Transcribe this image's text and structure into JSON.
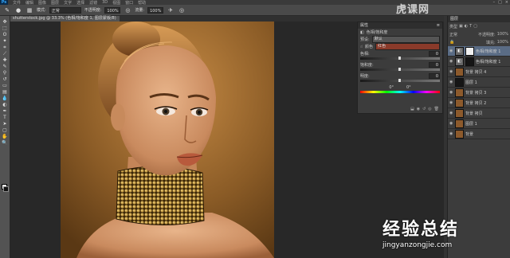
{
  "app": {
    "logo": "Ps"
  },
  "menubar": {
    "items": [
      "文件",
      "编辑",
      "图像",
      "图层",
      "文字",
      "选择",
      "滤镜",
      "3D",
      "视图",
      "窗口",
      "帮助"
    ]
  },
  "window_controls": [
    "–",
    "□",
    "×"
  ],
  "options": {
    "mode_value": "正常",
    "opacity_label": "不透明度:",
    "opacity_value": "100%",
    "flow_label": "流量:",
    "flow_value": "100%"
  },
  "document_tab": {
    "label": "shutterstock.jpg @ 33.3% (色相/饱和度 1, 图层蒙版/8)"
  },
  "properties": {
    "title": "属性",
    "subtitle": "色相/饱和度",
    "preset_label": "预设:",
    "preset_value": "默认",
    "channel_label": "颜色",
    "channel_value": "红色",
    "hue_label": "色相:",
    "hue_value": "0",
    "saturation_label": "饱和度:",
    "saturation_value": "0",
    "lightness_label": "明度:",
    "lightness_value": "0",
    "ranges": [
      "0°",
      "0°"
    ]
  },
  "layers": {
    "title": "图层",
    "kind_label": "类型",
    "mode_value": "正常",
    "opacity_label": "不透明度:",
    "opacity_value": "100%",
    "fill_label": "填充:",
    "fill_value": "100%",
    "items": [
      {
        "name": "色相/饱和度 1",
        "thumb": "mask",
        "selected": true
      },
      {
        "name": "色相/饱和度 1",
        "thumb": "dark"
      },
      {
        "name": "背景 拷贝 4",
        "thumb": "photo"
      },
      {
        "name": "图层 1",
        "thumb": "dark"
      },
      {
        "name": "背景 拷贝 3",
        "thumb": "photo"
      },
      {
        "name": "背景 拷贝 2",
        "thumb": "photo"
      },
      {
        "name": "背景 拷贝",
        "thumb": "photo"
      },
      {
        "name": "图层 1",
        "thumb": "photo"
      },
      {
        "name": "背景",
        "thumb": "photo"
      }
    ]
  },
  "watermark": {
    "top_text": "虎课网",
    "cn": "经验总结",
    "url": "jingyanzongjie.com"
  }
}
